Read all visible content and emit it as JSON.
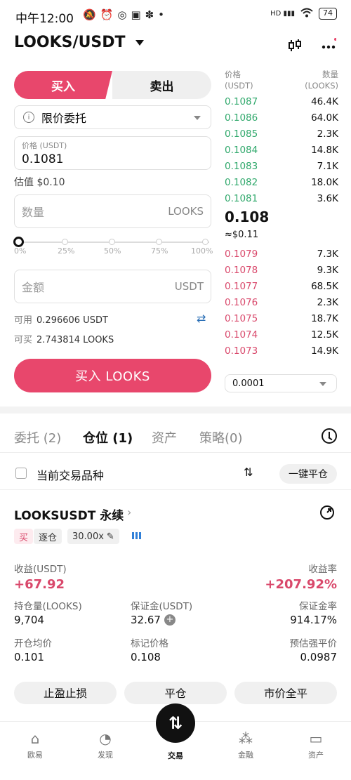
{
  "status_bar": {
    "time": "中午12:00",
    "icons_left": "🔕⏰◎▣✽•",
    "signal_label": "HD",
    "battery": "74"
  },
  "header": {
    "pair": "LOOKS/USDT",
    "candle_icon": "candlestick-icon",
    "more_icon": "more-icon"
  },
  "trade_form": {
    "buy_tab": "买入",
    "sell_tab": "卖出",
    "order_type": "限价委托",
    "price_label": "价格 (USDT)",
    "price_value": "0.1081",
    "estimate": "估值 $0.10",
    "qty_placeholder": "数量",
    "qty_unit": "LOOKS",
    "slider_ticks": [
      "0%",
      "25%",
      "50%",
      "75%",
      "100%"
    ],
    "slider_value_percent": 0,
    "amount_placeholder": "金额",
    "amount_unit": "USDT",
    "available_label": "可用",
    "available_value": "0.296606 USDT",
    "can_buy_label": "可买",
    "can_buy_value": "2.743814 LOOKS",
    "submit": "买入 LOOKS"
  },
  "order_book": {
    "price_header": "价格\n(USDT)",
    "qty_header": "数量\n(LOOKS)",
    "asks": [
      {
        "price": "0.1087",
        "qty": "46.4K"
      },
      {
        "price": "0.1086",
        "qty": "64.0K"
      },
      {
        "price": "0.1085",
        "qty": "2.3K"
      },
      {
        "price": "0.1084",
        "qty": "14.8K"
      },
      {
        "price": "0.1083",
        "qty": "7.1K"
      },
      {
        "price": "0.1082",
        "qty": "18.0K"
      },
      {
        "price": "0.1081",
        "qty": "3.6K"
      }
    ],
    "last_price": "0.108",
    "last_fiat": "≈$0.11",
    "bids": [
      {
        "price": "0.1079",
        "qty": "7.3K"
      },
      {
        "price": "0.1078",
        "qty": "9.3K"
      },
      {
        "price": "0.1077",
        "qty": "68.5K"
      },
      {
        "price": "0.1076",
        "qty": "2.3K"
      },
      {
        "price": "0.1075",
        "qty": "18.7K"
      },
      {
        "price": "0.1074",
        "qty": "12.5K"
      },
      {
        "price": "0.1073",
        "qty": "14.9K"
      }
    ],
    "precision": "0.0001"
  },
  "section_tabs": [
    {
      "label": "委托 (2)",
      "active": false
    },
    {
      "label": "仓位 (1)",
      "active": true
    },
    {
      "label": "资产",
      "active": false
    },
    {
      "label": "策略(0)",
      "active": false
    }
  ],
  "filter": {
    "current_pair_label": "当前交易品种",
    "close_all": "一键平仓"
  },
  "position": {
    "title": "LOOKSUSDT 永续",
    "side_tag": "买",
    "margin_tag": "逐仓",
    "leverage_tag": "30.00x",
    "pnl_label": "收益(USDT)",
    "pnl_value": "+67.92",
    "roe_label": "收益率",
    "roe_value": "+207.92%",
    "size_label": "持仓量(LOOKS)",
    "size_value": "9,704",
    "margin_label": "保证金(USDT)",
    "margin_value": "32.67",
    "margin_ratio_label": "保证金率",
    "margin_ratio_value": "914.17%",
    "entry_label": "开仓均价",
    "entry_value": "0.101",
    "mark_label": "标记价格",
    "mark_value": "0.108",
    "liq_label": "预估强平价",
    "liq_value": "0.0987",
    "btn_tpsl": "止盈止损",
    "btn_close": "平仓",
    "btn_market_close": "市价全平"
  },
  "bottom_nav": {
    "items": [
      {
        "label": "欧易",
        "icon": "home-icon"
      },
      {
        "label": "发现",
        "icon": "discover-icon"
      },
      {
        "label": "交易",
        "icon": "trade-icon"
      },
      {
        "label": "金融",
        "icon": "finance-icon"
      },
      {
        "label": "资产",
        "icon": "wallet-icon"
      }
    ]
  },
  "colors": {
    "buy": "#e8476c",
    "ask_green": "#2fa86b",
    "bid_red": "#d9486b",
    "link_blue": "#2b6fb6"
  }
}
